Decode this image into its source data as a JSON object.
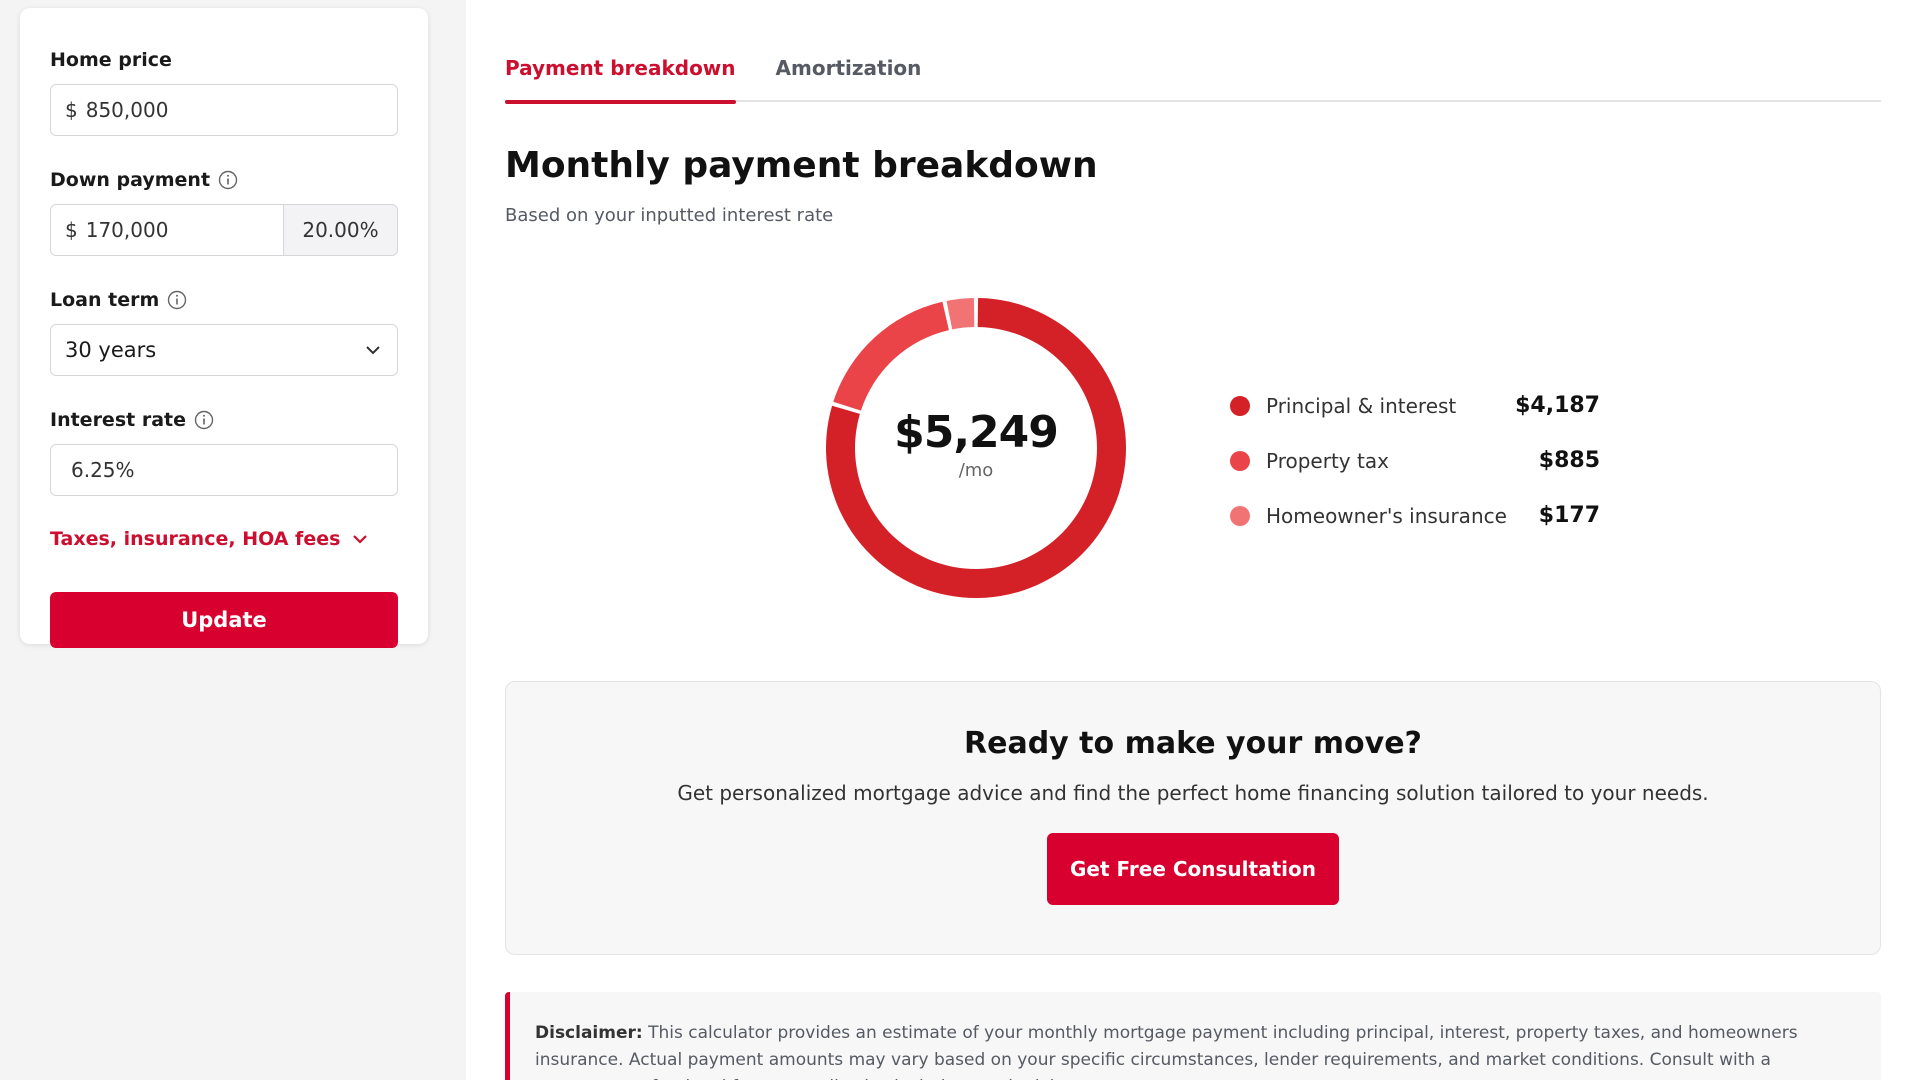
{
  "sidebar": {
    "home_price": {
      "label": "Home price",
      "prefix": "$",
      "value": "850,000"
    },
    "down_payment": {
      "label": "Down payment",
      "prefix": "$",
      "value": "170,000",
      "percent": "20.00%"
    },
    "loan_term": {
      "label": "Loan term",
      "value": "30 years"
    },
    "interest_rate": {
      "label": "Interest rate",
      "value": "6.25%"
    },
    "taxes_link": "Taxes, insurance, HOA fees",
    "update_label": "Update"
  },
  "tabs": [
    {
      "label": "Payment breakdown",
      "active": true
    },
    {
      "label": "Amortization",
      "active": false
    }
  ],
  "main": {
    "title": "Monthly payment breakdown",
    "subtitle": "Based on your inputted interest rate"
  },
  "chart_data": {
    "type": "pie",
    "total": "$5,249",
    "total_unit": "/mo",
    "series": [
      {
        "name": "Principal & interest",
        "value": 4187,
        "display": "$4,187",
        "color": "#d42027"
      },
      {
        "name": "Property tax",
        "value": 885,
        "display": "$885",
        "color": "#ea4348"
      },
      {
        "name": "Homeowner's insurance",
        "value": 177,
        "display": "$177",
        "color": "#f27373"
      }
    ]
  },
  "cta": {
    "title": "Ready to make your move?",
    "text": "Get personalized mortgage advice and find the perfect home financing solution tailored to your needs.",
    "button": "Get Free Consultation"
  },
  "disclaimer": {
    "label": "Disclaimer:",
    "text": "This calculator provides an estimate of your monthly mortgage payment including principal, interest, property taxes, and homeowners insurance. Actual payment amounts may vary based on your specific circumstances, lender requirements, and market conditions. Consult with a mortgage professional for personalized calculations and advice."
  },
  "colors": {
    "accent": "#d8002e",
    "accent_text": "#cc0f2f"
  },
  "icons": {
    "info": "info-icon",
    "dropdown": "chevron-down-icon",
    "taxes_toggle": "chevron-down-icon"
  }
}
